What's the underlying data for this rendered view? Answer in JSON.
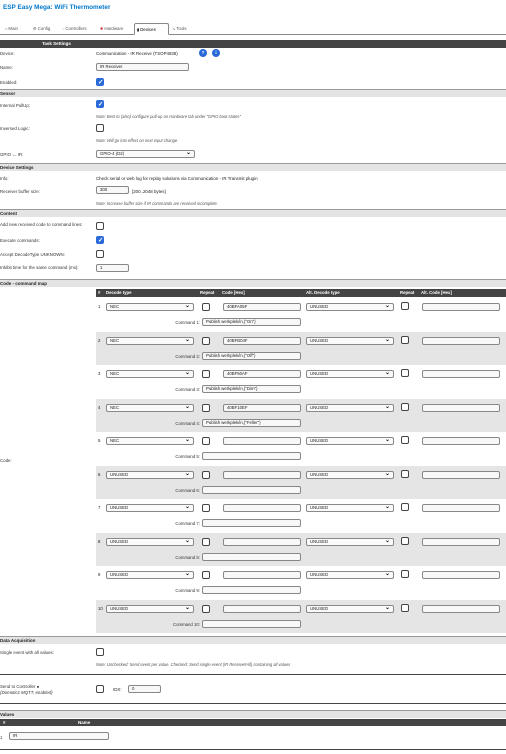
{
  "app": {
    "title": "ESP Easy Mega: WiFi Thermometer"
  },
  "tabs": [
    {
      "label": "Main",
      "icon": "home-icon"
    },
    {
      "label": "Config",
      "icon": "gear-icon"
    },
    {
      "label": "Controllers",
      "icon": "controllers-icon"
    },
    {
      "label": "Hardware",
      "icon": "hardware-icon"
    },
    {
      "label": "Devices",
      "icon": "plug-icon"
    },
    {
      "label": "Tools",
      "icon": "wrench-icon"
    }
  ],
  "active_tab": "Devices",
  "task": {
    "header": "Task Settings",
    "device_label": "Device:",
    "device_value": "Communication - IR Receive (TSOP4838)",
    "name_label": "Name:",
    "name_value": "IR Receiver",
    "enabled_label": "Enabled:",
    "enabled": true
  },
  "sensor": {
    "header": "Sensor",
    "pullup_label": "Internal PullUp:",
    "pullup": true,
    "pullup_note": "Note: Best to (also) configure pull-up on Hardware tab under \"GPIO boot states\"",
    "inverse_label": "Inversed Logic:",
    "inverse": false,
    "inverse_note": "Note: Will go into effect on next input change.",
    "gpio_label": "GPIO ← IR:",
    "gpio_value": "GPIO-4 (D2)"
  },
  "device_settings": {
    "header": "Device Settings",
    "info_label": "Info:",
    "info_value": "Check serial or web log for replay solutions via Communication - IR Transmit plugin",
    "buffer_label": "Receiver buffer size:",
    "buffer_value": "300",
    "buffer_range": "[200..2048 bytes]",
    "buffer_note": "Note: Increase buffer size if IR commands are received incomplete."
  },
  "content": {
    "header": "Content",
    "add_label": "Add new received code to command lines:",
    "add": false,
    "execute_label": "Execute commands:",
    "execute": true,
    "accept_label": "Accept DecodeType UNKNOWN:",
    "accept": false,
    "inhibit_label": "Inhibit time for the same command (ms):",
    "inhibit_value": "1"
  },
  "code_map": {
    "header": "Code - command map",
    "code_label": "Code:",
    "columns": {
      "num": "#",
      "decode": "Decode type",
      "repeat": "Repeat",
      "code": "Code [Hex]",
      "alt_decode": "Alt. Decode type",
      "alt_repeat": "Repeat",
      "alt_code": "Alt. Code [Hex]"
    },
    "rows": [
      {
        "num": "1",
        "decode": "NEC",
        "code": "40BFA05F",
        "alt": "UNUSED",
        "cmd_label": "Command 1:",
        "cmd": "Publish werkplek/in,{\"On\"}"
      },
      {
        "num": "2",
        "decode": "NEC",
        "code": "40BFB04F",
        "alt": "UNUSED",
        "cmd_label": "Command 2:",
        "cmd": "Publish werkplek/in,{\"Off\"}"
      },
      {
        "num": "3",
        "decode": "NEC",
        "code": "40BF50AF",
        "alt": "UNUSED",
        "cmd_label": "Command 3:",
        "cmd": "Publish werkplek/in,{\"Dim\"}"
      },
      {
        "num": "4",
        "decode": "NEC",
        "code": "40BF10EF",
        "alt": "UNUSED",
        "cmd_label": "Command 4:",
        "cmd": "Publish werkplek/in,{\"Feller\"}"
      },
      {
        "num": "5",
        "decode": "NEC",
        "code": "",
        "alt": "UNUSED",
        "cmd_label": "Command 5:",
        "cmd": ""
      },
      {
        "num": "6",
        "decode": "UNUSED",
        "code": "",
        "alt": "UNUSED",
        "cmd_label": "Command 6:",
        "cmd": ""
      },
      {
        "num": "7",
        "decode": "UNUSED",
        "code": "",
        "alt": "UNUSED",
        "cmd_label": "Command 7:",
        "cmd": ""
      },
      {
        "num": "8",
        "decode": "UNUSED",
        "code": "",
        "alt": "UNUSED",
        "cmd_label": "Command 8:",
        "cmd": ""
      },
      {
        "num": "9",
        "decode": "UNUSED",
        "code": "",
        "alt": "UNUSED",
        "cmd_label": "Command 9:",
        "cmd": ""
      },
      {
        "num": "10",
        "decode": "UNUSED",
        "code": "",
        "alt": "UNUSED",
        "cmd_label": "Command 10:",
        "cmd": ""
      }
    ]
  },
  "data_acq": {
    "header": "Data Acquisition",
    "single_label": "Single event with all values:",
    "single": false,
    "single_note": "Note: Unchecked: Send event per value. Checked: Send single event (IR Receive#All) containing all values",
    "send_label": "Send to Controller",
    "send_sub": "(Domoticz MQTT, enabled)",
    "send": false,
    "idx_label": "IDX:",
    "idx_value": "0"
  },
  "values": {
    "header": "Values",
    "col_num": "#",
    "col_name": "Name",
    "row_num": "1",
    "row_name": "IR"
  },
  "colors": {
    "accent": "#0077cc",
    "checkbox": "#2a6ad8",
    "header": "#444444",
    "alt_row": "#e5e5e5"
  }
}
